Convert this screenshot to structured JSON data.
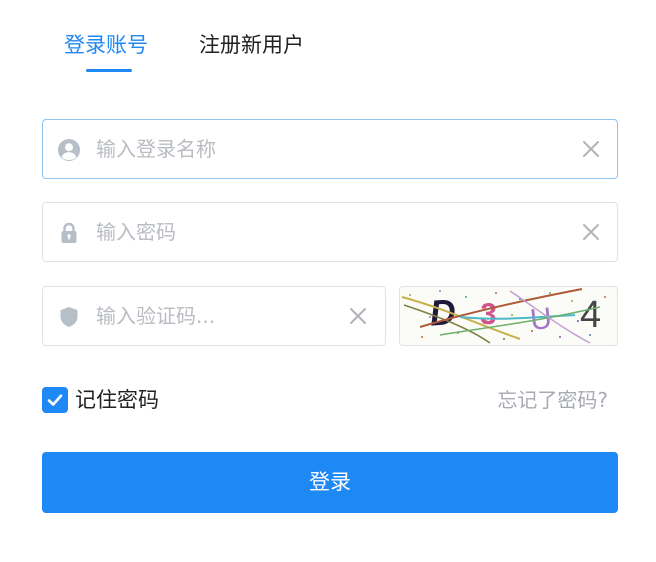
{
  "tabs": {
    "login_label": "登录账号",
    "register_label": "注册新用户",
    "active": "login"
  },
  "username": {
    "placeholder": "输入登录名称",
    "value": "",
    "icon": "user-icon"
  },
  "password": {
    "placeholder": "输入密码",
    "value": "",
    "icon": "lock-icon"
  },
  "captcha": {
    "placeholder": "输入验证码...",
    "value": "",
    "icon": "shield-icon",
    "image_text": [
      "D",
      "3",
      "U",
      "4"
    ],
    "image_text_colors": [
      "#1f1a3a",
      "#d0548e",
      "#a575c9",
      "#454545"
    ]
  },
  "remember": {
    "label": "记住密码",
    "checked": true
  },
  "forgot_label": "忘记了密码?",
  "submit_label": "登录",
  "colors": {
    "accent": "#1e88f5",
    "placeholder": "#b9bcc2",
    "border": "#dfe3e8",
    "icon": "#b6bec8",
    "muted_link": "#a7abb1"
  }
}
